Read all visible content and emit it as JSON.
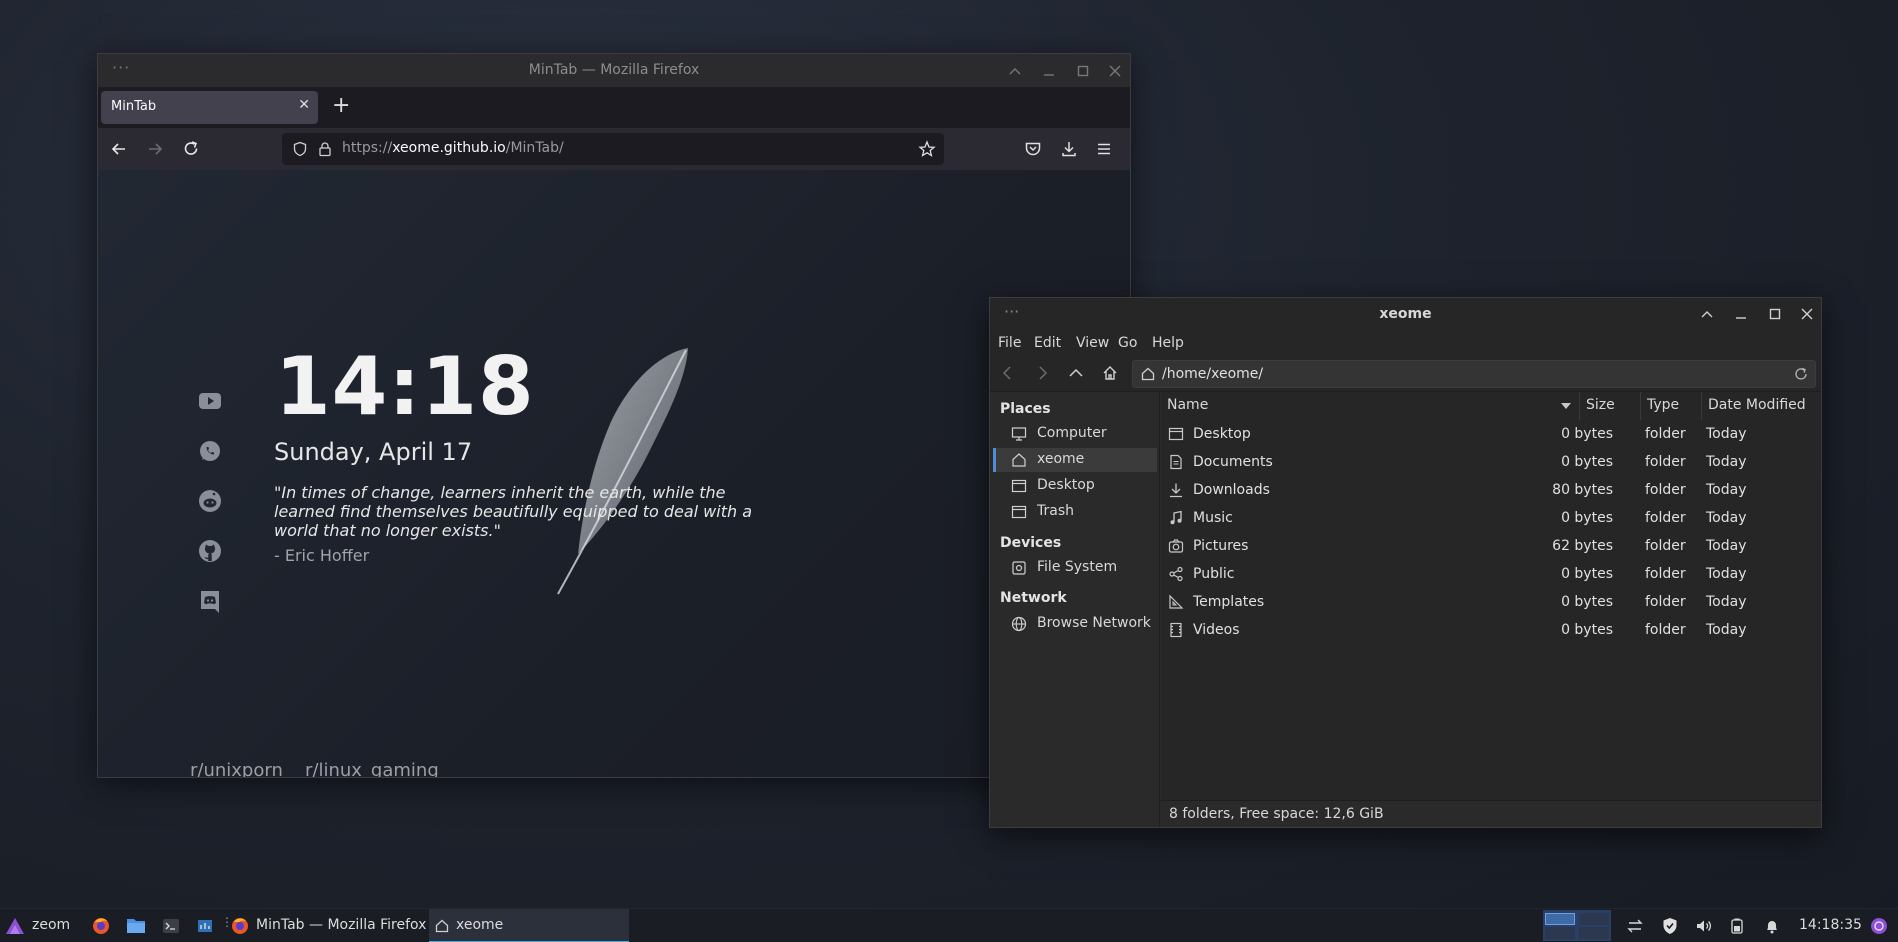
{
  "firefox": {
    "window_title": "MinTab — Mozilla Firefox",
    "tab_label": "MinTab",
    "url_scheme": "https://",
    "url_host": "xeome.github.io",
    "url_path": "/MinTab/",
    "page": {
      "time": "14:18",
      "date": "Sunday, April 17",
      "quote": "\"In times of change, learners inherit the earth, while the learned find themselves beautifully equipped to deal with a world that no longer exists.\"",
      "author": "- Eric Hoffer",
      "social_icons": [
        "youtube-icon",
        "whatsapp-icon",
        "reddit-icon",
        "github-icon",
        "discord-icon"
      ],
      "links": [
        "r/unixporn",
        "r/linux_gaming"
      ]
    }
  },
  "file_manager": {
    "window_title": "xeome",
    "menu": [
      "File",
      "Edit",
      "View",
      "Go",
      "Help"
    ],
    "location": "/home/xeome/",
    "sidebar": {
      "places_header": "Places",
      "places": [
        "Computer",
        "xeome",
        "Desktop",
        "Trash"
      ],
      "devices_header": "Devices",
      "devices": [
        "File System"
      ],
      "network_header": "Network",
      "network": [
        "Browse Network"
      ],
      "selected": "xeome"
    },
    "columns": {
      "name": "Name",
      "size": "Size",
      "type": "Type",
      "date": "Date Modified"
    },
    "rows": [
      {
        "name": "Desktop",
        "size": "0 bytes",
        "type": "folder",
        "date": "Today",
        "icon": "desktop-folder-icon"
      },
      {
        "name": "Documents",
        "size": "0 bytes",
        "type": "folder",
        "date": "Today",
        "icon": "document-icon"
      },
      {
        "name": "Downloads",
        "size": "80 bytes",
        "type": "folder",
        "date": "Today",
        "icon": "download-icon"
      },
      {
        "name": "Music",
        "size": "0 bytes",
        "type": "folder",
        "date": "Today",
        "icon": "music-icon"
      },
      {
        "name": "Pictures",
        "size": "62 bytes",
        "type": "folder",
        "date": "Today",
        "icon": "camera-icon"
      },
      {
        "name": "Public",
        "size": "0 bytes",
        "type": "folder",
        "date": "Today",
        "icon": "share-icon"
      },
      {
        "name": "Templates",
        "size": "0 bytes",
        "type": "folder",
        "date": "Today",
        "icon": "template-icon"
      },
      {
        "name": "Videos",
        "size": "0 bytes",
        "type": "folder",
        "date": "Today",
        "icon": "film-icon"
      }
    ],
    "status": "8 folders, Free space: 12,6 GiB"
  },
  "taskbar": {
    "menu_label": "zeom",
    "task_firefox": "MinTab — Mozilla Firefox",
    "task_fm": "xeome",
    "clock": "14:18:35"
  },
  "colors": {
    "accent": "#3daee9",
    "selection": "#4e8cd6",
    "firefox_tab": "#42414d"
  }
}
